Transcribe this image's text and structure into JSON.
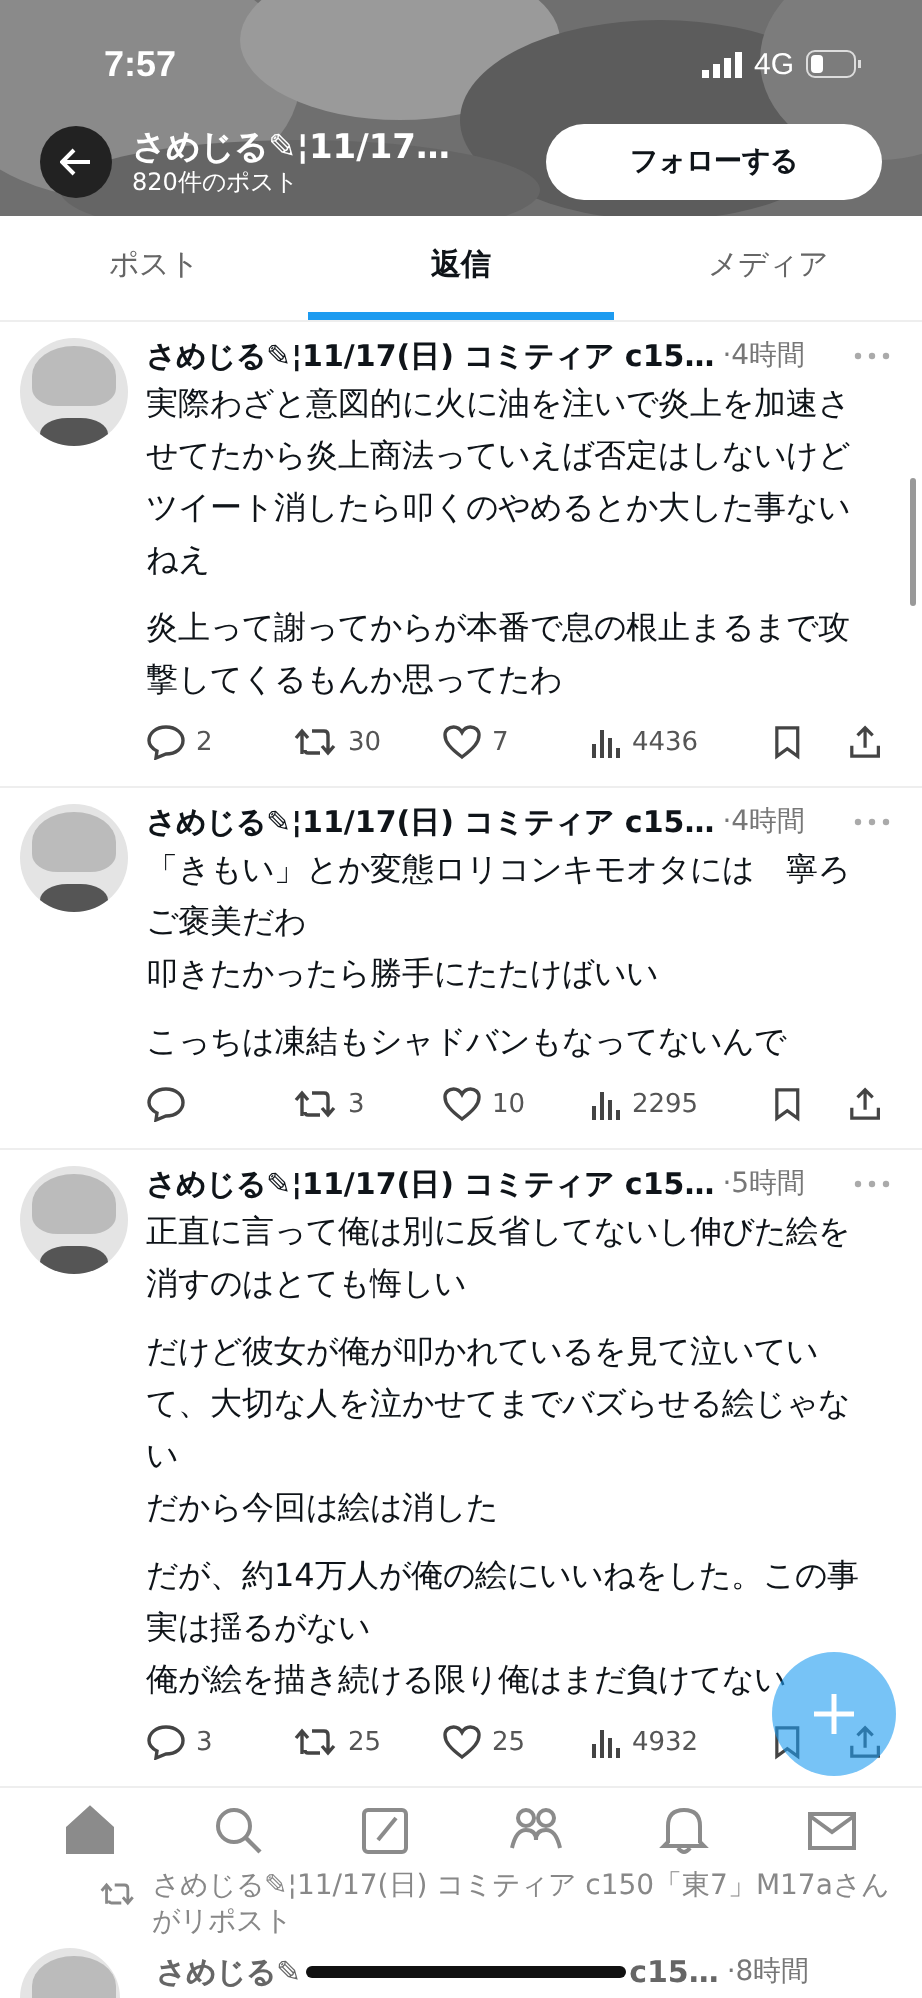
{
  "status_bar": {
    "time": "7:57",
    "network": "4G"
  },
  "header": {
    "title": "さめじる✎¦11/17…",
    "subtitle": "820件のポスト",
    "follow_button": "フォローする"
  },
  "tabs": [
    {
      "label": "ポスト",
      "selected": false
    },
    {
      "label": "返信",
      "selected": true
    },
    {
      "label": "メディア",
      "selected": false
    }
  ],
  "posts": [
    {
      "author": "さめじる✎¦11/17(日) コミティア c15…",
      "time": "·4時間",
      "paragraphs": [
        [
          "実際わざと意図的に火に油を注いで炎上を加速させてたから炎上商法っていえば否定はしないけどツイート消したら叩くのやめるとか大した事ないねえ"
        ],
        [
          "炎上って謝ってからが本番で息の根止まるまで攻撃してくるもんか思ってたわ"
        ]
      ],
      "replies": "2",
      "reposts": "30",
      "likes": "7",
      "views": "4436"
    },
    {
      "author": "さめじる✎¦11/17(日) コミティア c15…",
      "time": "·4時間",
      "paragraphs": [
        [
          "「きもい」とか変態ロリコンキモオタには　寧ろご褒美だわ",
          "叩きたかったら勝手にたたけばいい"
        ],
        [
          "こっちは凍結もシャドバンもなってないんで"
        ]
      ],
      "reposts": "3",
      "likes": "10",
      "views": "2295"
    },
    {
      "author": "さめじる✎¦11/17(日) コミティア c15…",
      "time": "·5時間",
      "paragraphs": [
        [
          "正直に言って俺は別に反省してないし伸びた絵を消すのはとても悔しい"
        ],
        [
          "だけど彼女が俺が叩かれているを見て泣いていて、大切な人を泣かせてまでバズらせる絵じゃない",
          "だから今回は絵は消した"
        ],
        [
          "だが、約14万人が俺の絵にいいねをした。この事実は揺るがない",
          "俺が絵を描き続ける限り俺はまだ負けてない"
        ]
      ],
      "replies": "3",
      "reposts": "25",
      "likes": "25",
      "views": "4932"
    }
  ],
  "repost_notice": "さめじる✎¦11/17(日) コミティア c150「東7」M17aさんがリポスト",
  "partial_post": {
    "author_start": "さめじる✎",
    "author_end": "c15…",
    "time": "·8時間"
  },
  "nav": [
    {
      "kind": "home",
      "selected": true
    },
    {
      "kind": "search",
      "selected": false
    },
    {
      "kind": "compose",
      "selected": false
    },
    {
      "kind": "communities",
      "selected": false
    },
    {
      "kind": "notifications",
      "selected": false
    },
    {
      "kind": "messages",
      "selected": false
    }
  ]
}
